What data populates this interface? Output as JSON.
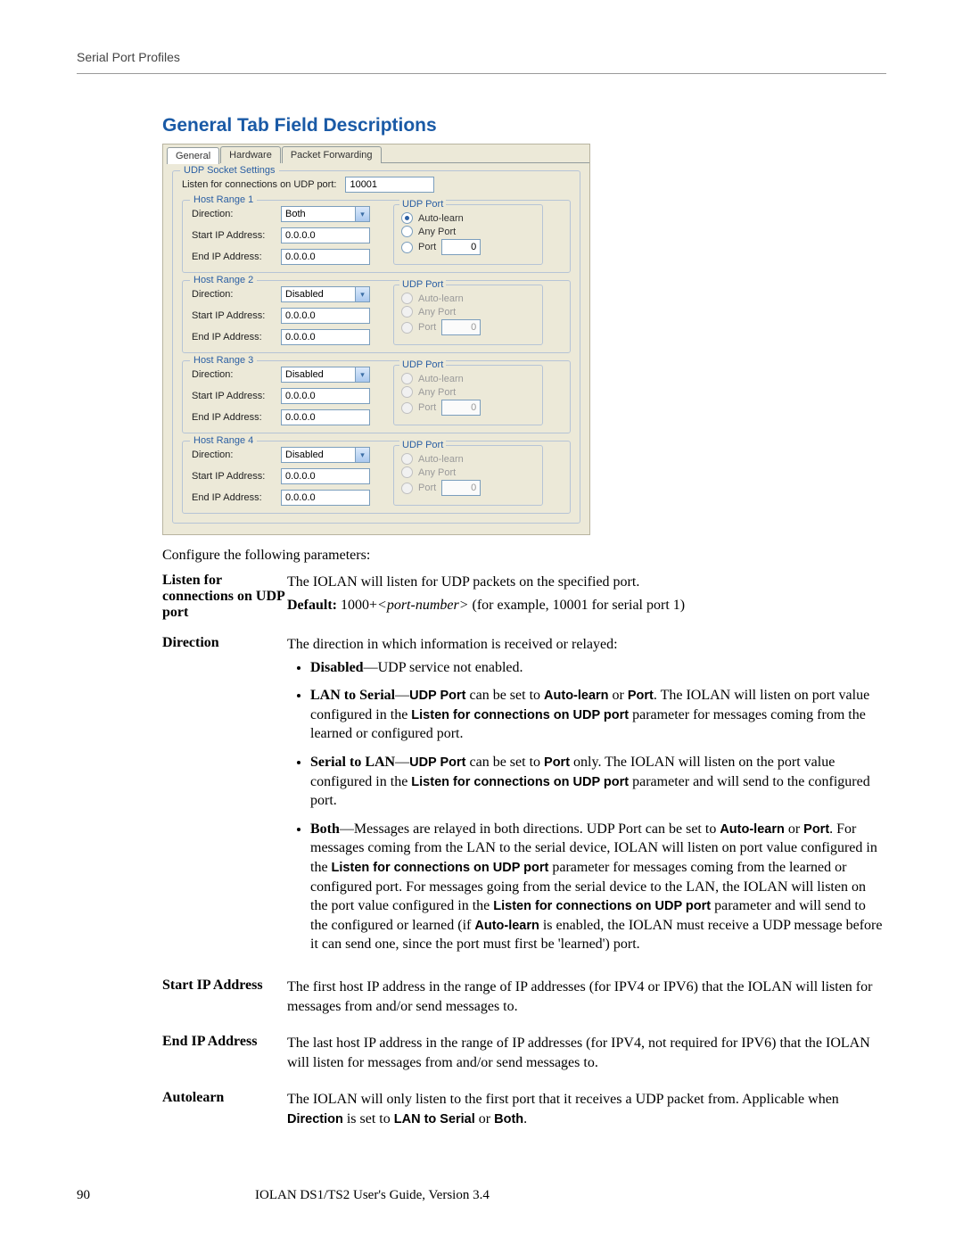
{
  "header": {
    "runhead": "Serial Port Profiles"
  },
  "section_title": "General Tab Field Descriptions",
  "dialog": {
    "tabs": {
      "general": "General",
      "hardware": "Hardware",
      "packet": "Packet Forwarding"
    },
    "socket_group": "UDP Socket Settings",
    "listen_label": "Listen for connections on UDP port:",
    "listen_value": "10001",
    "field_direction": "Direction:",
    "field_start": "Start IP Address:",
    "field_end": "End IP Address:",
    "udp_legend": "UDP Port",
    "opt_autolearn": "Auto-learn",
    "opt_anyport": "Any Port",
    "opt_port": "Port",
    "ranges": [
      {
        "title": "Host Range 1",
        "direction": "Both",
        "start": "0.0.0.0",
        "end": "0.0.0.0",
        "enabled": true,
        "port": "0"
      },
      {
        "title": "Host Range 2",
        "direction": "Disabled",
        "start": "0.0.0.0",
        "end": "0.0.0.0",
        "enabled": false,
        "port": "0"
      },
      {
        "title": "Host Range 3",
        "direction": "Disabled",
        "start": "0.0.0.0",
        "end": "0.0.0.0",
        "enabled": false,
        "port": "0"
      },
      {
        "title": "Host Range 4",
        "direction": "Disabled",
        "start": "0.0.0.0",
        "end": "0.0.0.0",
        "enabled": false,
        "port": "0"
      }
    ]
  },
  "intro": "Configure the following parameters:",
  "defs": {
    "listen": {
      "term": "Listen for connections on UDP port",
      "desc": "The IOLAN will listen for UDP packets on the specified port.",
      "default_prefix": "Default:",
      "default_a": " 1000+",
      "default_ital": "<port-number>",
      "default_b": " (for example, 10001 for serial port 1)"
    },
    "direction": {
      "term": "Direction",
      "desc": "The direction in which information is received or relayed:",
      "disabled": {
        "b": "Disabled",
        "t": "—UDP service not enabled."
      },
      "lan": {
        "b1": "LAN to Serial",
        "t1": "—",
        "b2": "UDP Port",
        "t2": " can be set to ",
        "b3": "Auto-learn",
        "t3": " or ",
        "b4": "Port",
        "t4": ". The IOLAN will listen on port value configured in the ",
        "b5": "Listen for connections on UDP port",
        "t5": " parameter for messages coming from the learned or configured port."
      },
      "serial": {
        "b1": "Serial to LAN",
        "t1": "—",
        "b2": "UDP Port",
        "t2": " can be set to ",
        "b3": "Port",
        "t3": " only. The IOLAN will listen on the port value configured in the ",
        "b4": "Listen for connections on UDP port",
        "t4": " parameter and will send to the configured port."
      },
      "both": {
        "b1": "Both",
        "t1": "—Messages are relayed in both directions. UDP Port can be set to ",
        "b2": "Auto-learn",
        "t2": " or ",
        "b3": "Port",
        "t3": ". For messages coming from the LAN to the serial device, IOLAN will listen on port value configured in the ",
        "b4": "Listen for connections on UDP port",
        "t4": " parameter for messages coming from the learned or configured port. For messages going from the serial device to the LAN, the IOLAN will listen on the port value configured in the ",
        "b5": "Listen for connections on UDP port",
        "t5": " parameter and will send to the configured or learned (if ",
        "b6": "Auto-learn",
        "t6": " is enabled, the IOLAN must receive a UDP message before it can send one, since the port must first be 'learned') port."
      }
    },
    "start_ip": {
      "term": "Start IP Address",
      "desc": "The first host IP address in the range of IP addresses (for IPV4 or IPV6) that the IOLAN will listen for messages from and/or send messages to."
    },
    "end_ip": {
      "term": "End IP Address",
      "desc": "The last host IP address in the range of IP addresses (for IPV4, not required for IPV6) that the IOLAN will listen for messages from and/or send messages to."
    },
    "autolearn": {
      "term": "Autolearn",
      "t1": "The IOLAN will only listen to the first port that it receives a UDP packet from. Applicable when ",
      "b1": "Direction",
      "t2": " is set to ",
      "b2": "LAN to Serial",
      "t3": " or ",
      "b3": "Both",
      "t4": "."
    }
  },
  "footer": {
    "page": "90",
    "book": "IOLAN DS1/TS2 User's Guide, Version 3.4"
  }
}
